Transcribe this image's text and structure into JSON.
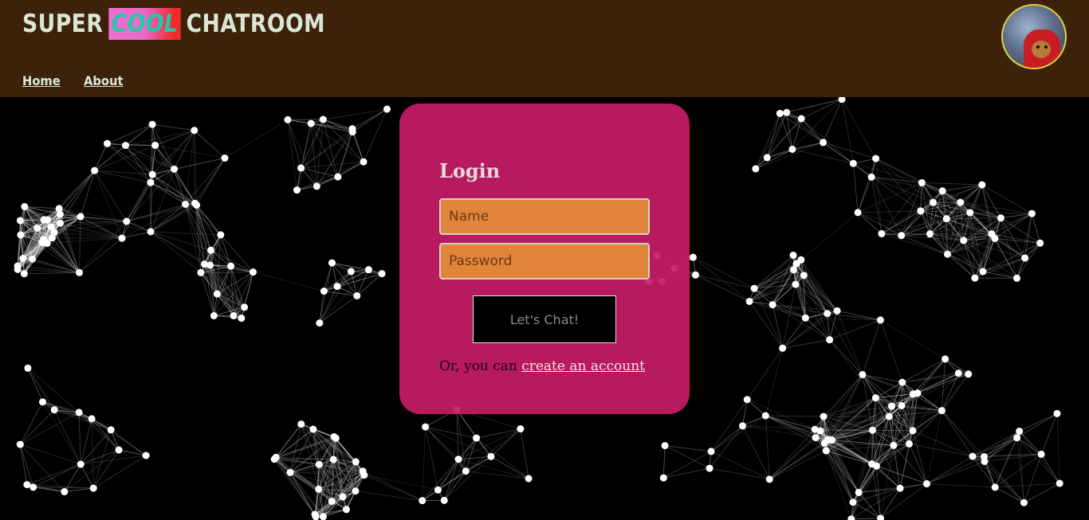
{
  "header": {
    "brand": {
      "part1": "SUPER",
      "part2": "COOL",
      "part3": "CHATROOM"
    },
    "nav": {
      "home": "Home",
      "about": "About"
    },
    "avatar_alt": "user avatar"
  },
  "login": {
    "title": "Login",
    "name_placeholder": "Name",
    "password_placeholder": "Password",
    "submit_label": "Let's Chat!",
    "alt_prefix": "Or, you can ",
    "alt_link": "create an account"
  },
  "colors": {
    "header_bg": "#3e2109",
    "card_bg": "#c61c66",
    "input_bg": "#e0853a",
    "text_light": "#d9e8d6"
  }
}
